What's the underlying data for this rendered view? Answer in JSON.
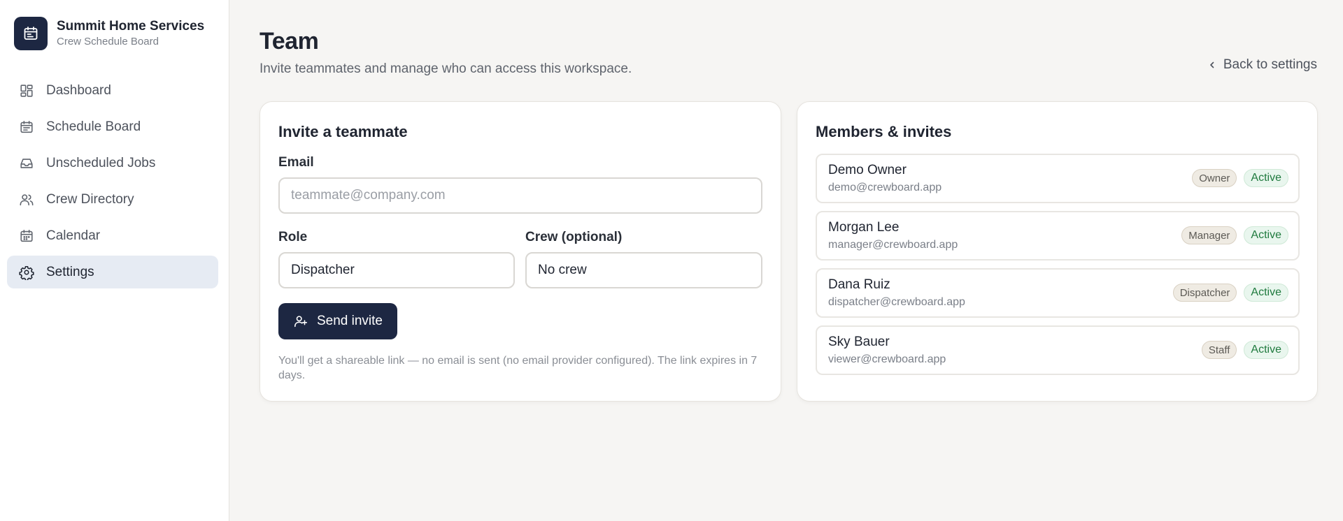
{
  "brand": {
    "name": "Summit Home Services",
    "subtitle": "Crew Schedule Board",
    "logo_icon": "calendar-icon",
    "color": "#1d2742"
  },
  "sidebar": {
    "items": [
      {
        "label": "Dashboard",
        "icon": "dashboard-grid-icon",
        "active": false
      },
      {
        "label": "Schedule Board",
        "icon": "calendar-list-icon",
        "active": false
      },
      {
        "label": "Unscheduled Jobs",
        "icon": "inbox-tray-icon",
        "active": false
      },
      {
        "label": "Crew Directory",
        "icon": "users-icon",
        "active": false
      },
      {
        "label": "Calendar",
        "icon": "calendar-icon",
        "active": false
      },
      {
        "label": "Settings",
        "icon": "gear-icon",
        "active": true
      }
    ]
  },
  "header": {
    "title": "Team",
    "subtitle": "Invite teammates and manage who can access this workspace.",
    "back_label": "Back to settings"
  },
  "invite": {
    "title": "Invite a teammate",
    "email_label": "Email",
    "email_placeholder": "teammate@company.com",
    "email_value": "",
    "role_label": "Role",
    "role_value": "Dispatcher",
    "crew_label": "Crew (optional)",
    "crew_value": "No crew",
    "send_label": "Send invite",
    "hint": "You'll get a shareable link — no email is sent (no email provider configured). The link expires in 7 days."
  },
  "members": {
    "title": "Members & invites",
    "list": [
      {
        "name": "Demo Owner",
        "email": "demo@crewboard.app",
        "role": "Owner",
        "status": "Active"
      },
      {
        "name": "Morgan Lee",
        "email": "manager@crewboard.app",
        "role": "Manager",
        "status": "Active"
      },
      {
        "name": "Dana Ruiz",
        "email": "dispatcher@crewboard.app",
        "role": "Dispatcher",
        "status": "Active"
      },
      {
        "name": "Sky Bauer",
        "email": "viewer@crewboard.app",
        "role": "Staff",
        "status": "Active"
      }
    ]
  },
  "colors": {
    "primary": "#1d2742",
    "active_nav_bg": "#e6ebf3",
    "status_active": "#1f7a3e",
    "role_badge_bg": "#efebe3"
  }
}
